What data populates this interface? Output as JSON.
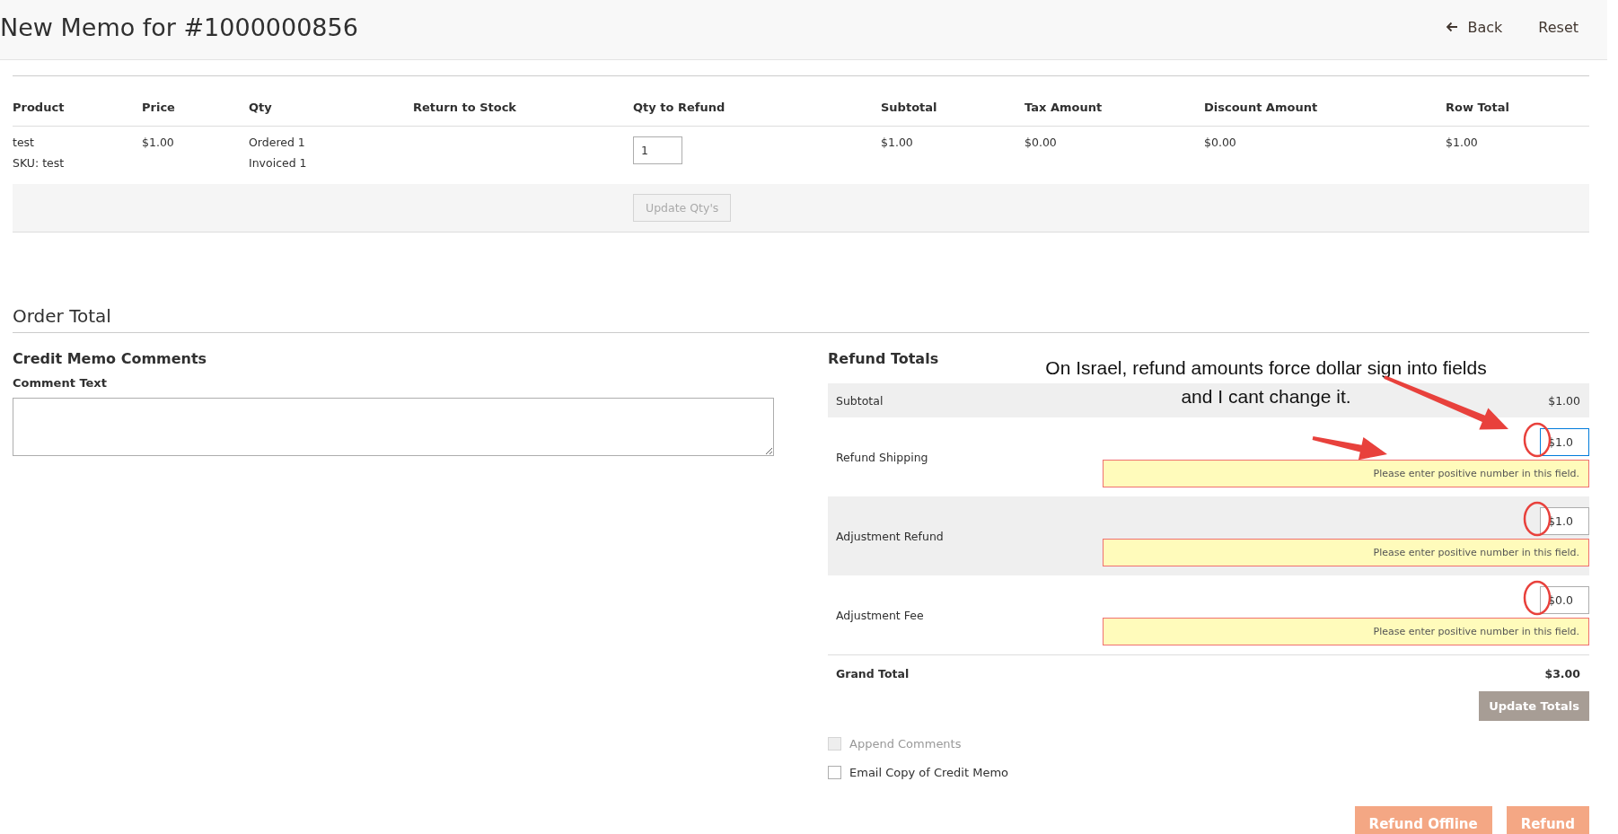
{
  "header": {
    "title": "New Memo for #1000000856",
    "actions": [
      {
        "label": "Back",
        "kind": "back"
      },
      {
        "label": "Reset",
        "kind": "plain"
      }
    ]
  },
  "items_section": {
    "columns": [
      "Product",
      "Price",
      "Qty",
      "Return to Stock",
      "Qty to Refund",
      "Subtotal",
      "Tax Amount",
      "Discount Amount",
      "Row Total"
    ],
    "rows": [
      {
        "product": "test",
        "sku": "SKU: test",
        "price": "$1.00",
        "qty": [
          "Ordered 1",
          "Invoiced 1"
        ],
        "qty_to_refund": "1",
        "subtotal": "$1.00",
        "tax_amount": "$0.00",
        "discount_amount": "$0.00",
        "row_total": "$1.00"
      }
    ],
    "update_button": {
      "label": "Update Qty's",
      "disabled": true
    }
  },
  "order_total": {
    "title": "Order Total",
    "comments": {
      "title": "Credit Memo Comments",
      "label": "Comment Text"
    },
    "refund_totals": {
      "title": "Refund Totals",
      "subtotal": {
        "label": "Subtotal",
        "value": "$1.00"
      },
      "fields": [
        {
          "label": "Refund Shipping",
          "value": "$1.0",
          "focused": true,
          "error": "Please enter positive number in this field."
        },
        {
          "label": "Adjustment Refund",
          "value": "$1.0",
          "focused": false,
          "error": "Please enter positive number in this field."
        },
        {
          "label": "Adjustment Fee",
          "value": "$0.0",
          "focused": false,
          "error": "Please enter positive number in this field."
        }
      ],
      "grand_total": {
        "label": "Grand Total",
        "value": "$3.00"
      },
      "update_button": {
        "label": "Update Totals"
      },
      "options": [
        {
          "label": "Append Comments",
          "checked": false,
          "disabled": true
        },
        {
          "label": "Email Copy of Credit Memo",
          "checked": false,
          "disabled": false
        }
      ],
      "actions": [
        "Refund Offline",
        "Refund"
      ]
    }
  },
  "annotation": {
    "lines": [
      "On Israel, refund amounts force dollar sign into fields",
      "and I cant change it."
    ]
  }
}
